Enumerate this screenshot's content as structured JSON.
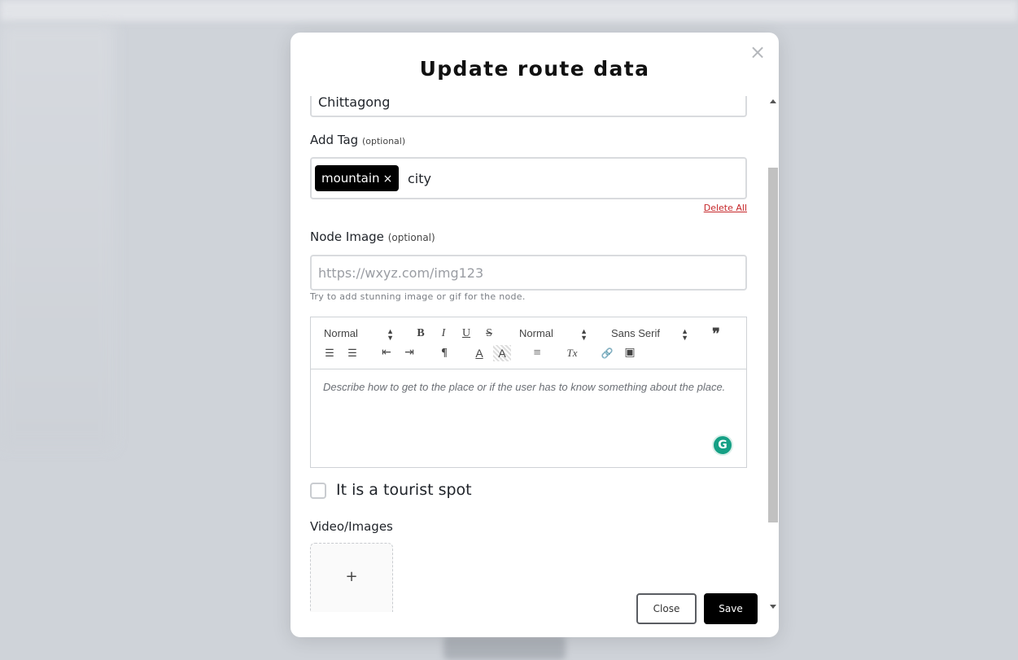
{
  "modal": {
    "title": "Update route data",
    "close_icon": "×"
  },
  "location": {
    "value": "Chittagong"
  },
  "tags": {
    "label": "Add Tag",
    "optional": "(optional)",
    "chips": [
      {
        "label": "mountain",
        "remove": "×"
      }
    ],
    "input_value": "city",
    "delete_all": "Delete All"
  },
  "node_image": {
    "label": "Node Image",
    "optional": "(optional)",
    "placeholder": "https://wxyz.com/img123",
    "hint": "Try to add stunning image or gif for the node."
  },
  "editor": {
    "header_select": "Normal",
    "size_select": "Normal",
    "font_select": "Sans Serif",
    "buttons": {
      "bold": "B",
      "italic": "I",
      "underline": "U",
      "strike": "S",
      "blockquote": "❞",
      "ordered_list": "☰",
      "bullet_list": "☰",
      "outdent": "⇤",
      "indent": "⇥",
      "direction": "¶",
      "color": "A",
      "background": "A",
      "align": "≡",
      "clean": "Tx",
      "link": "🔗",
      "image": "▣"
    },
    "placeholder": "Describe how to get to the place or if the user has to know something about the place.",
    "grammarly_icon": "G"
  },
  "tourist": {
    "label": "It is a tourist spot",
    "checked": false
  },
  "media": {
    "label": "Video/Images",
    "plus": "+"
  },
  "footer": {
    "close_label": "Close",
    "save_label": "Save"
  }
}
